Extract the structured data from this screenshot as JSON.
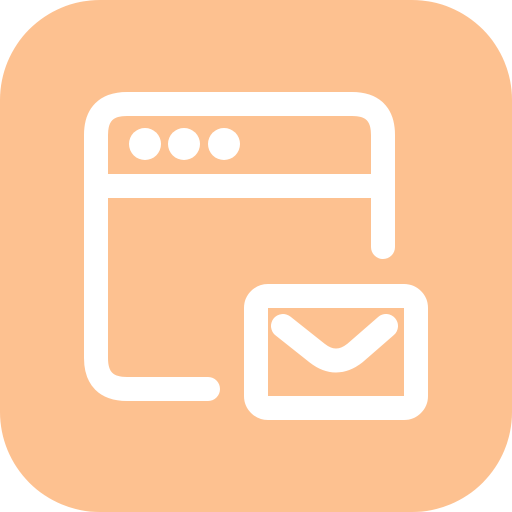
{
  "icon": {
    "name": "browser-window-with-mail-icon",
    "colors": {
      "background": "#FDC190",
      "foreground": "#FFFFFF"
    }
  }
}
